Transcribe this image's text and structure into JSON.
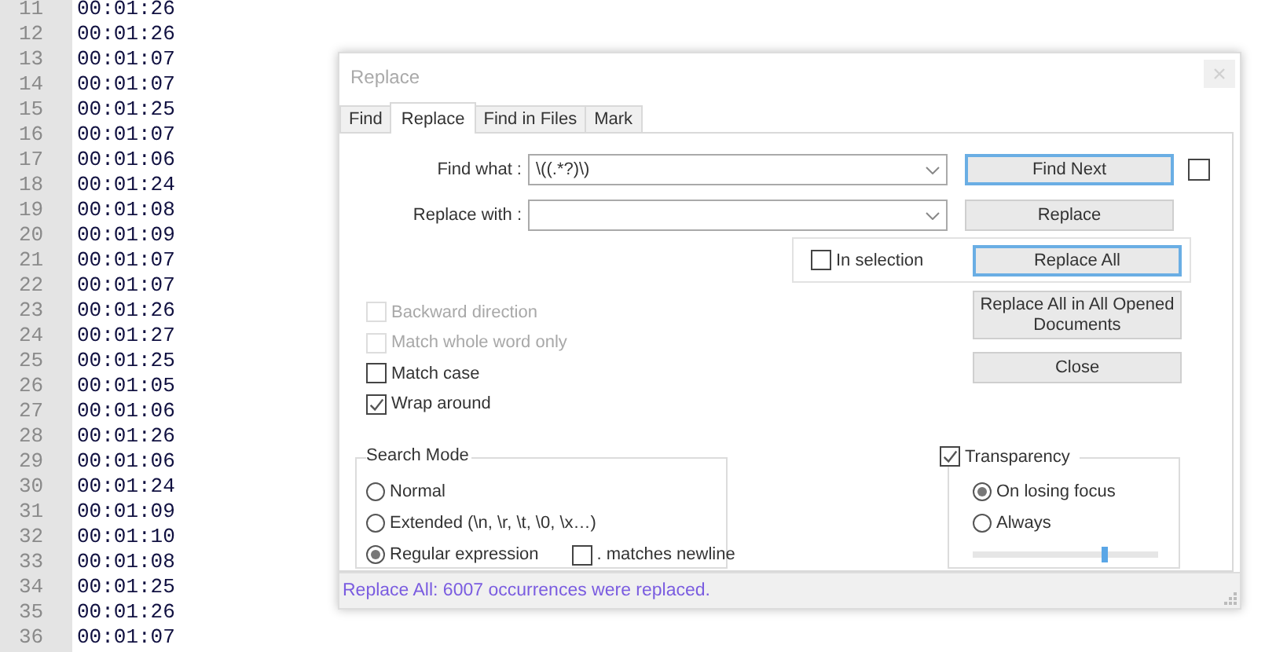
{
  "editor": {
    "lines": [
      {
        "number": "11",
        "text": "00:01:26"
      },
      {
        "number": "12",
        "text": "00:01:26"
      },
      {
        "number": "13",
        "text": "00:01:07"
      },
      {
        "number": "14",
        "text": "00:01:07"
      },
      {
        "number": "15",
        "text": "00:01:25"
      },
      {
        "number": "16",
        "text": "00:01:07"
      },
      {
        "number": "17",
        "text": "00:01:06"
      },
      {
        "number": "18",
        "text": "00:01:24"
      },
      {
        "number": "19",
        "text": "00:01:08"
      },
      {
        "number": "20",
        "text": "00:01:09"
      },
      {
        "number": "21",
        "text": "00:01:07"
      },
      {
        "number": "22",
        "text": "00:01:07"
      },
      {
        "number": "23",
        "text": "00:01:26"
      },
      {
        "number": "24",
        "text": "00:01:27"
      },
      {
        "number": "25",
        "text": "00:01:25"
      },
      {
        "number": "26",
        "text": "00:01:05"
      },
      {
        "number": "27",
        "text": "00:01:06"
      },
      {
        "number": "28",
        "text": "00:01:26"
      },
      {
        "number": "29",
        "text": "00:01:06"
      },
      {
        "number": "30",
        "text": "00:01:24"
      },
      {
        "number": "31",
        "text": "00:01:09"
      },
      {
        "number": "32",
        "text": "00:01:10"
      },
      {
        "number": "33",
        "text": "00:01:08"
      },
      {
        "number": "34",
        "text": "00:01:25"
      },
      {
        "number": "35",
        "text": "00:01:26"
      },
      {
        "number": "36",
        "text": "00:01:07"
      }
    ]
  },
  "dialog": {
    "title": "Replace",
    "tabs": [
      {
        "label": "Find",
        "selected": false
      },
      {
        "label": "Replace",
        "selected": true
      },
      {
        "label": "Find in Files",
        "selected": false
      },
      {
        "label": "Mark",
        "selected": false
      }
    ],
    "find_what": {
      "label": "Find what :",
      "value": "\\((.*?)\\)"
    },
    "replace_with": {
      "label": "Replace with :"
    },
    "side_checkbox": {
      "checked": false
    },
    "in_selection": {
      "label": "In selection",
      "checked": false
    },
    "buttons": [
      {
        "label": "Find Next",
        "default": true
      },
      {
        "label": "Replace",
        "default": false
      },
      {
        "label": "Replace All",
        "default": true
      },
      {
        "label": "Replace All in All Opened Documents",
        "default": false
      },
      {
        "label": "Close",
        "default": false
      }
    ],
    "options": [
      {
        "label": "Backward direction",
        "checked": false,
        "disabled": true
      },
      {
        "label": "Match whole word only",
        "checked": false,
        "disabled": true
      },
      {
        "label": "Match case",
        "checked": false,
        "disabled": false
      },
      {
        "label": "Wrap around",
        "checked": true,
        "disabled": false
      }
    ],
    "search_mode": {
      "title": "Search Mode",
      "modes": [
        {
          "label": "Normal",
          "selected": false
        },
        {
          "label": "Extended (\\n, \\r, \\t, \\0, \\x…)",
          "selected": false
        },
        {
          "label": "Regular expression",
          "selected": true
        }
      ],
      "matches_newline": {
        "label": ". matches newline",
        "checked": false
      }
    },
    "transparency": {
      "label": "Transparency",
      "checked": true,
      "modes": [
        {
          "label": "On losing focus",
          "selected": true
        },
        {
          "label": "Always",
          "selected": false
        }
      ],
      "level": 0.71
    },
    "status": "Replace All: 6007 occurrences were replaced."
  }
}
